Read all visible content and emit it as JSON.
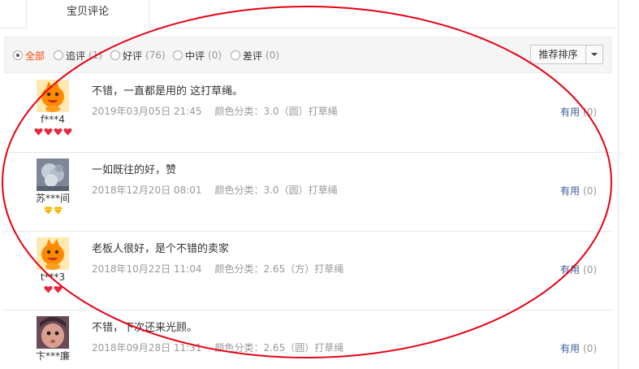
{
  "tab": {
    "label": "宝贝评论"
  },
  "filters": [
    {
      "label": "全部",
      "count": "",
      "checked": true
    },
    {
      "label": "追评",
      "count": "(1)",
      "checked": false
    },
    {
      "label": "好评",
      "count": "(76)",
      "checked": false
    },
    {
      "label": "中评",
      "count": "(0)",
      "checked": false
    },
    {
      "label": "差评",
      "count": "(0)",
      "checked": false
    }
  ],
  "sort": {
    "label": "推荐排序"
  },
  "reviews": [
    {
      "user": "f***4",
      "content": "不错，一直都是用的 这打草绳。",
      "date": "2019年03月05日 21:45",
      "sku": "颜色分类：3.0（圆）打草绳",
      "useful_label": "有用",
      "useful_count": "(0)",
      "avatar": "orange-mascot",
      "badge": "red-heart",
      "badge_count": 4
    },
    {
      "user": "苏***间",
      "content": "一如既往的好，赞",
      "date": "2018年12月20日 08:01",
      "sku": "颜色分类：3.0（圆）打草绳",
      "useful_label": "有用",
      "useful_count": "(0)",
      "avatar": "fluffy-photo",
      "badge": "yellow-diamond",
      "badge_count": 2
    },
    {
      "user": "t***3",
      "content": "老板人很好，是个不错的卖家",
      "date": "2018年10月22日 11:04",
      "sku": "颜色分类：2.65（方）打草绳",
      "useful_label": "有用",
      "useful_count": "(0)",
      "avatar": "orange-mascot",
      "badge": "red-heart",
      "badge_count": 2
    },
    {
      "user": "卞***廉",
      "content": "不错，下次还来光顾。",
      "date": "2018年09月28日 11:31",
      "sku": "颜色分类：2.65（圆）打草绳",
      "useful_label": "有用",
      "useful_count": "(0)",
      "avatar": "baby-photo",
      "badge": "",
      "badge_count": 0
    }
  ],
  "colors": {
    "accent": "#ff4400",
    "link": "#3c5b9a",
    "annotation": "#e60012"
  }
}
